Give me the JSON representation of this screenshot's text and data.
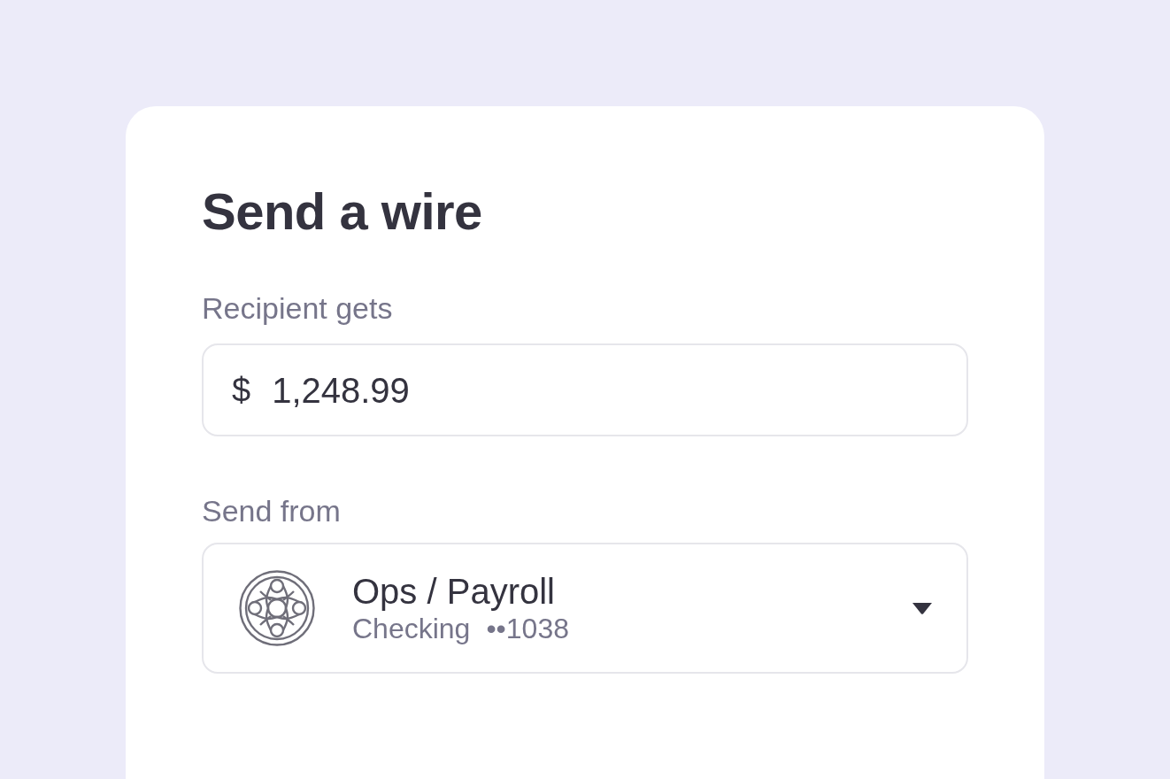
{
  "title": "Send a wire",
  "amount_field": {
    "label": "Recipient gets",
    "currency": "$",
    "value": "1,248.99"
  },
  "account_select": {
    "label": "Send from",
    "name": "Ops / Payroll",
    "account_type": "Checking",
    "account_mask": "••1038"
  }
}
